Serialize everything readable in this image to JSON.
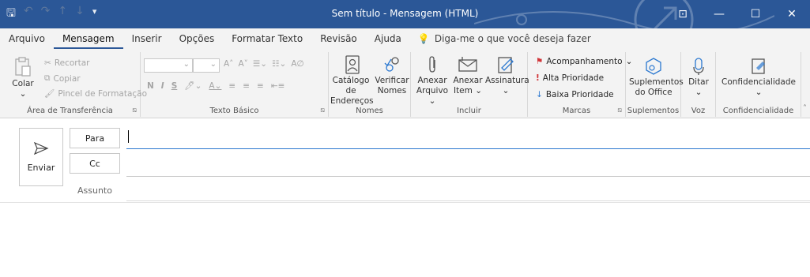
{
  "window": {
    "title": "Sem título  -  Mensagem (HTML)",
    "controls": [
      "restore-ribbon",
      "minimize",
      "maximize",
      "close"
    ]
  },
  "menu": {
    "items": [
      "Arquivo",
      "Mensagem",
      "Inserir",
      "Opções",
      "Formatar Texto",
      "Revisão",
      "Ajuda"
    ],
    "active": "Mensagem",
    "tell_me": "Diga-me o que você deseja fazer"
  },
  "ribbon": {
    "clipboard": {
      "paste": "Colar",
      "cut": "Recortar",
      "copy": "Copiar",
      "format_painter": "Pincel de Formatação",
      "label": "Área de Transferência"
    },
    "basic_text": {
      "bold": "N",
      "italic": "I",
      "underline": "S",
      "label": "Texto Básico"
    },
    "names": {
      "address_book": "Catálogo de Endereços",
      "check_names": "Verificar Nomes",
      "label": "Nomes"
    },
    "include": {
      "attach_file": "Anexar Arquivo",
      "attach_item": "Anexar Item",
      "signature": "Assinatura",
      "label": "Incluir"
    },
    "tags": {
      "followup": "Acompanhamento",
      "high": "Alta Prioridade",
      "low": "Baixa Prioridade",
      "label": "Marcas"
    },
    "addins": {
      "office_addins": "Suplementos do Office",
      "label": "Suplementos"
    },
    "voice": {
      "dictate": "Ditar",
      "label": "Voz"
    },
    "sensitivity": {
      "btn": "Confidencialidade",
      "label": "Confidencialidade"
    }
  },
  "compose": {
    "send": "Enviar",
    "to": "Para",
    "cc": "Cc",
    "subject": "Assunto"
  },
  "colors": {
    "titlebar": "#2b5797",
    "ribbon": "#f3f3f3",
    "accent": "#2b5797",
    "high_priority": "#d13438",
    "low_priority": "#2b78d0"
  }
}
